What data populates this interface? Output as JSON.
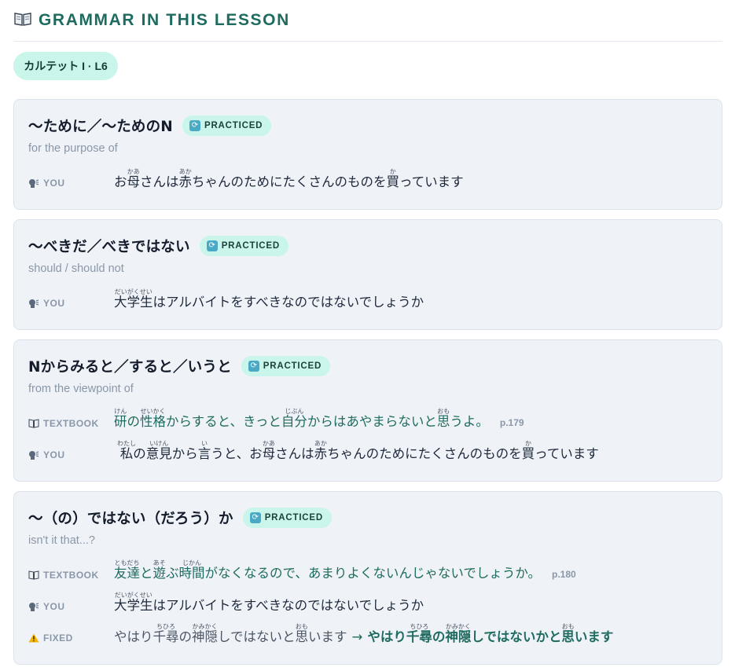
{
  "header": {
    "title": "GRAMMAR IN THIS LESSON",
    "icon": "open-book-icon",
    "accent": "#1f6b5f"
  },
  "lesson": {
    "label": "カルテット I · L6"
  },
  "badge_label": "PRACTICED",
  "labels": {
    "you": "YOU",
    "textbook": "TEXTBOOK",
    "fixed": "FIXED"
  },
  "colors": {
    "badge_bg": "#c9f5ea",
    "card_bg": "#eff3f8",
    "muted": "#8a97a8"
  },
  "cards": [
    {
      "title": "〜ために／〜ためのN",
      "meaning": "for the purpose of",
      "you": [
        {
          "t": "お"
        },
        {
          "t": "母",
          "r": "かあ"
        },
        {
          "t": "さんは"
        },
        {
          "t": "赤",
          "r": "あか"
        },
        {
          "t": "ちゃんのためにたくさんのものを"
        },
        {
          "t": "買",
          "r": "か"
        },
        {
          "t": "っています"
        }
      ]
    },
    {
      "title": "〜べきだ／べきではない",
      "meaning": "should / should not",
      "you": [
        {
          "t": "大学生",
          "r": "だいがくせい"
        },
        {
          "t": "はアルバイトをすべきなのではないでしょうか"
        }
      ]
    },
    {
      "title": "Nからみると／すると／いうと",
      "meaning": "from the viewpoint of",
      "textbook": [
        {
          "t": "研",
          "r": "けん"
        },
        {
          "t": "の"
        },
        {
          "t": "性格",
          "r": "せいかく"
        },
        {
          "t": "からすると、きっと"
        },
        {
          "t": "自分",
          "r": "じぶん"
        },
        {
          "t": "からはあやまらないと"
        },
        {
          "t": "思",
          "r": "おも"
        },
        {
          "t": "うよ。"
        }
      ],
      "textbook_page": "p.179",
      "you": [
        {
          "t": "私",
          "r": "わたし"
        },
        {
          "t": "の"
        },
        {
          "t": "意見",
          "r": "いけん"
        },
        {
          "t": "から"
        },
        {
          "t": "言",
          "r": "い"
        },
        {
          "t": "うと、お"
        },
        {
          "t": "母",
          "r": "かあ"
        },
        {
          "t": "さんは"
        },
        {
          "t": "赤",
          "r": "あか"
        },
        {
          "t": "ちゃんのためにたくさんのものを"
        },
        {
          "t": "買",
          "r": "か"
        },
        {
          "t": "っています"
        }
      ]
    },
    {
      "title": "〜（の）ではない（だろう）か",
      "meaning": "isn't it that...?",
      "textbook": [
        {
          "t": "友達",
          "r": "ともだち"
        },
        {
          "t": "と"
        },
        {
          "t": "遊",
          "r": "あそ"
        },
        {
          "t": "ぶ"
        },
        {
          "t": "時間",
          "r": "じかん"
        },
        {
          "t": "がなくなるので、あまりよくないんじゃないでしょうか。"
        }
      ],
      "textbook_page": "p.180",
      "you": [
        {
          "t": "大学生",
          "r": "だいがくせい"
        },
        {
          "t": "はアルバイトをすべきなのではないでしょうか"
        }
      ],
      "fixed_original": [
        {
          "t": "やはり"
        },
        {
          "t": "千尋",
          "r": "ちひろ"
        },
        {
          "t": "の"
        },
        {
          "t": "神隠",
          "r": "かみかく"
        },
        {
          "t": "しではないと"
        },
        {
          "t": "思",
          "r": "おも"
        },
        {
          "t": "います"
        }
      ],
      "fixed_arrow": "→",
      "fixed_corrected": [
        {
          "t": "やはり"
        },
        {
          "t": "千尋",
          "r": "ちひろ"
        },
        {
          "t": "の"
        },
        {
          "t": "神隠",
          "r": "かみかく"
        },
        {
          "t": "しではないかと"
        },
        {
          "t": "思",
          "r": "おも"
        },
        {
          "t": "います"
        }
      ]
    }
  ]
}
